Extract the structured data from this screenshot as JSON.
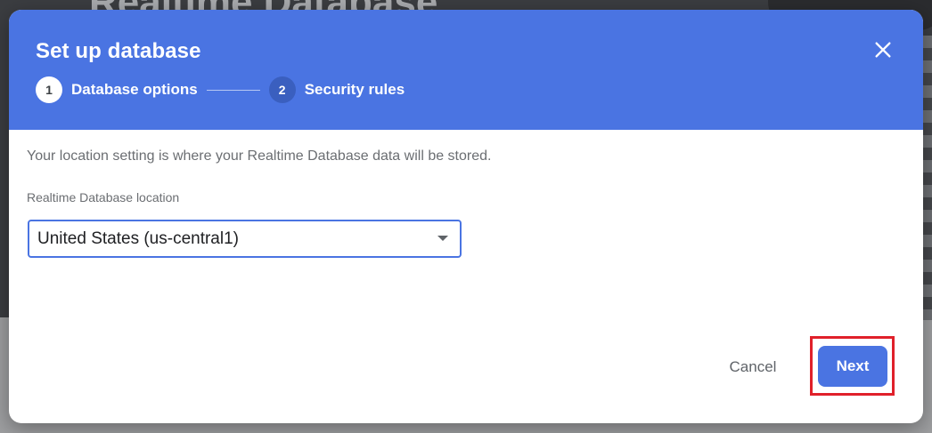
{
  "backdrop": {
    "title": "Realtime Database"
  },
  "dialog": {
    "title": "Set up database",
    "close_icon": "close-icon",
    "steps": [
      {
        "number": "1",
        "label": "Database options",
        "active": true
      },
      {
        "number": "2",
        "label": "Security rules",
        "active": false
      }
    ],
    "description": "Your location setting is where your Realtime Database data will be stored.",
    "location_field": {
      "label": "Realtime Database location",
      "value": "United States (us-central1)"
    },
    "actions": {
      "cancel_label": "Cancel",
      "next_label": "Next"
    }
  },
  "colors": {
    "header": "#4a74e2",
    "primary_button": "#4a74e2",
    "highlight_box": "#e0202a"
  }
}
